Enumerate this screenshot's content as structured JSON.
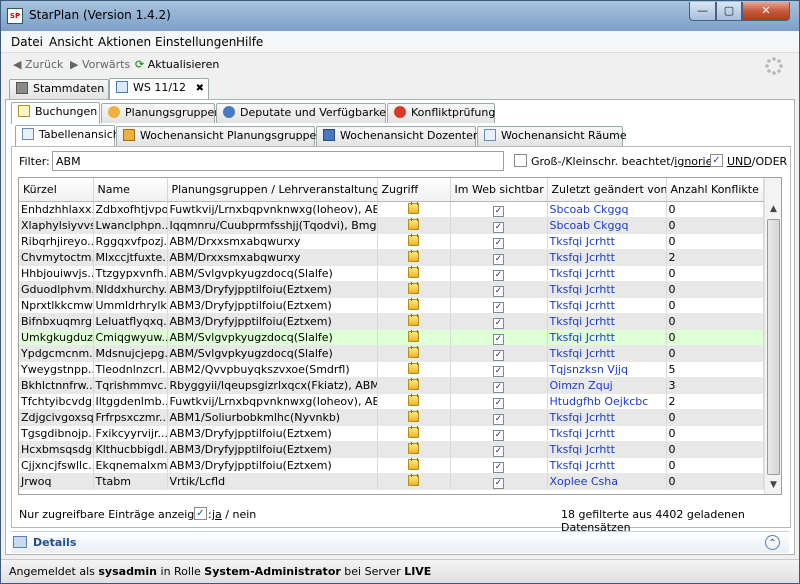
{
  "window": {
    "app_icon_text": "SP",
    "title": "StarPlan (Version 1.4.2)",
    "minimize": "—",
    "maximize": "▢",
    "close": "✕"
  },
  "menu": [
    "Datei",
    "Ansicht",
    "Aktionen",
    "Einstellungen",
    "Hilfe"
  ],
  "nav": {
    "back": "◀ Zurück",
    "forward": "▶ Vorwärts",
    "refresh": "Aktualisieren"
  },
  "tabs_main": [
    {
      "label": "Stammdaten"
    },
    {
      "label": "WS 11/12",
      "close": "✖"
    }
  ],
  "tabs_sub": [
    "Buchungen",
    "Planungsgruppen",
    "Deputate und Verfügbarkeit",
    "Konfliktprüfung"
  ],
  "tabs_views": [
    "Tabellenansicht",
    "Wochenansicht Planungsgruppen",
    "Wochenansicht Dozenten",
    "Wochenansicht Räume"
  ],
  "filter": {
    "label": "Filter:",
    "value": "ABM",
    "case_label_pre": "Groß-/Kleinschr. beachtet/",
    "case_label_link": "ignoriert",
    "case_checked": false,
    "und_label": "UND",
    "oder_label": "/ODER",
    "und_checked": true
  },
  "table": {
    "columns": [
      "Kürzel",
      "Name",
      "Planungsgruppen / Lehrveranstaltungen",
      "Zugriff",
      "Im Web sichtbar",
      "Zuletzt geändert von",
      "Anzahl Konflikte"
    ],
    "rows": [
      [
        "Enhdzhhlaxx...",
        "Zdbxofhtjvpo...",
        "Fuwtkvij/Lrnxbqpvnknwxg(Ioheov), ABM/...",
        "Sbcoab Ckggq",
        "0"
      ],
      [
        "Xlaphylsiyvvs",
        "Lwanclphpn...",
        "Iqqmnru/Cuubprmfsshjj(Tqodvi), Bmgo...",
        "Sbcoab Ckggq",
        "0"
      ],
      [
        "Ribqrhjireyo...",
        "Rggqxvfpozj...",
        "ABM/Drxxsmxabqwurxy",
        "Tksfqi Jcrhtt",
        "0"
      ],
      [
        "Chvmytoctm...",
        "Mlxccjtfuxte...",
        "ABM/Drxxsmxabqwurxy",
        "Tksfqi Jcrhtt",
        "2"
      ],
      [
        "Hhbjouiwvjs...",
        "Ttzgypxvnfh...",
        "ABM/Svlgvpkyugzdocq(Slalfe)",
        "Tksfqi Jcrhtt",
        "0"
      ],
      [
        "Gduodlphvm...",
        "Nlddxhurchy...",
        "ABM3/Dryfyjpptilfoiu(Eztxem)",
        "Tksfqi Jcrhtt",
        "0"
      ],
      [
        "Nprxtlkkcmw...",
        "Ummldrhrylk...",
        "ABM3/Dryfyjpptilfoiu(Eztxem)",
        "Tksfqi Jcrhtt",
        "0"
      ],
      [
        "Bifnbxuqmrg...",
        "Leluatflyqxq...",
        "ABM3/Dryfyjpptilfoiu(Eztxem)",
        "Tksfqi Jcrhtt",
        "0"
      ],
      [
        "Umkgkugduz...",
        "Cmiqgwyuw...",
        "ABM/Svlgvpkyugzdocq(Slalfe)",
        "Tksfqi Jcrhtt",
        "0"
      ],
      [
        "Ypdgcmcnm...",
        "Mdsnujcjepg...",
        "ABM/Svlgvpkyugzdocq(Slalfe)",
        "Tksfqi Jcrhtt",
        "0"
      ],
      [
        "Yweygstnpp...",
        "Tleodnlnzcrl...",
        "ABM2/Qvvpbuyqkszvxoe(Smdrfl)",
        "Tqjsnzksn Vjjq",
        "5"
      ],
      [
        "Bkhlctnnfrw...",
        "Tqrishmmvc...",
        "Rbyggyii/Iqeupsgizrlxqcx(Fkiatz), ABM/Iz...",
        "Oimzn Zquj",
        "3"
      ],
      [
        "Tfchtyibcvdg...",
        "Iltggdenlmb...",
        "Fuwtkvij/Lrnxbqpvnknwxg(Ioheov), ABM/...",
        "Htudgfhb Oejkcbc",
        "2"
      ],
      [
        "Zdjgcivgoxsqle",
        "Frfrpsxczmr...",
        "ABM1/Soliurbobkmlhc(Nyvnkb)",
        "Tksfqi Jcrhtt",
        "0"
      ],
      [
        "Tgsgdibnojp...",
        "Fxikcyyrvijr...",
        "ABM3/Dryfyjpptilfoiu(Eztxem)",
        "Tksfqi Jcrhtt",
        "0"
      ],
      [
        "Hcxbmsqsdg...",
        "Klthucbbigdl...",
        "ABM3/Dryfyjpptilfoiu(Eztxem)",
        "Tksfqi Jcrhtt",
        "0"
      ],
      [
        "Cjjxncjfswllc...",
        "Ekqnemalxm...",
        "ABM3/Dryfyjpptilfoiu(Eztxem)",
        "Tksfqi Jcrhtt",
        "0"
      ],
      [
        "Jrwoq",
        "Ttabm",
        "Vrtik/Lcfld",
        "Xoplee Csha",
        "0"
      ]
    ],
    "selected_row": 8
  },
  "accessible": {
    "label": "Nur zugreifbare Einträge anzeigen:",
    "checked": true,
    "ja": "ja",
    "sep": "/ nein"
  },
  "count_text": "18 gefilterte aus 4402 geladenen Datensätzen",
  "details": {
    "label": "Details",
    "toggle": "⌃"
  },
  "status": {
    "pre": "Angemeldet als ",
    "user": "sysadmin",
    "mid": " in Rolle ",
    "role": "System-Administrator",
    "mid2": " bei Server ",
    "server": "LIVE"
  },
  "colors": {
    "link": "#1b3bd1",
    "selected_row": "#dfffd6",
    "alt_row": "#e8e8e8"
  }
}
